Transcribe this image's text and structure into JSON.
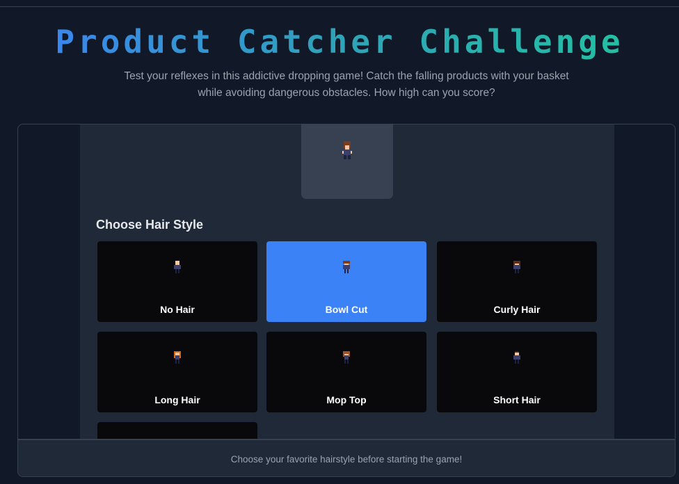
{
  "header": {
    "title": "Product Catcher Challenge",
    "subtitle": "Test your reflexes in this addictive dropping game! Catch the falling products with your basket while avoiding dangerous obstacles. How high can you score?"
  },
  "hair_selector": {
    "heading": "Choose Hair Style",
    "selected": "Bowl Cut",
    "options": [
      {
        "label": "No Hair",
        "hair_color": "#f4c7a2"
      },
      {
        "label": "Bowl Cut",
        "hair_color": "#7a3b1e"
      },
      {
        "label": "Curly Hair",
        "hair_color": "#5c2e1a"
      },
      {
        "label": "Long Hair",
        "hair_color": "#d2691e"
      },
      {
        "label": "Mop Top",
        "hair_color": "#a0522d"
      },
      {
        "label": "Short Hair",
        "hair_color": "#4a2515"
      },
      {
        "label": ""
      }
    ]
  },
  "footer": {
    "text": "Choose your favorite hairstyle before starting the game!"
  },
  "colors": {
    "accent": "#3b82f6",
    "title_gradient": [
      "#3b82f6",
      "#22c4a0"
    ]
  }
}
